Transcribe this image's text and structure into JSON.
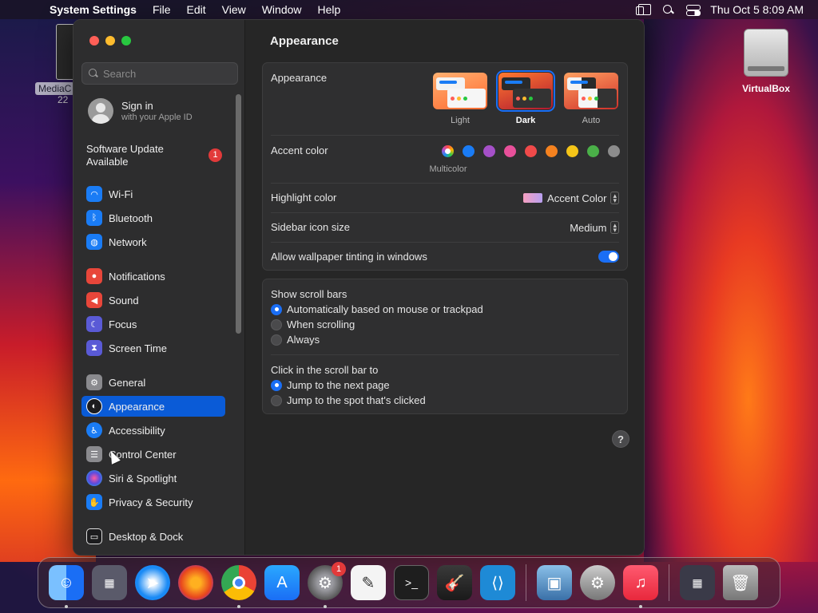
{
  "menubar": {
    "app_name": "System Settings",
    "items": [
      "File",
      "Edit",
      "View",
      "Window",
      "Help"
    ],
    "clock": "Thu Oct 5  8:09 AM"
  },
  "desktop": {
    "virtualbox_label": "VirtualBox",
    "mediac_label": "MediaC",
    "mediac_sub": "22"
  },
  "sidebar": {
    "search_placeholder": "Search",
    "signin_title": "Sign in",
    "signin_sub": "with your Apple ID",
    "update_line1": "Software Update",
    "update_line2": "Available",
    "update_badge": "1",
    "items": [
      {
        "label": "Wi-Fi",
        "icon": "wifi-icon",
        "color": "#1a7cf5"
      },
      {
        "label": "Bluetooth",
        "icon": "bluetooth-icon",
        "color": "#1a7cf5"
      },
      {
        "label": "Network",
        "icon": "globe-icon",
        "color": "#1a7cf5"
      },
      {
        "label": "Notifications",
        "icon": "bell-icon",
        "color": "#e8463a"
      },
      {
        "label": "Sound",
        "icon": "speaker-icon",
        "color": "#e8463a"
      },
      {
        "label": "Focus",
        "icon": "moon-icon",
        "color": "#5a5ad6"
      },
      {
        "label": "Screen Time",
        "icon": "hourglass-icon",
        "color": "#5a5ad6"
      },
      {
        "label": "General",
        "icon": "gear-icon",
        "color": "#8a8a8e"
      },
      {
        "label": "Appearance",
        "icon": "appearance-icon",
        "color": "#1c1c1e"
      },
      {
        "label": "Accessibility",
        "icon": "accessibility-icon",
        "color": "#1a7cf5"
      },
      {
        "label": "Control Center",
        "icon": "control-center-icon",
        "color": "#8a8a8e"
      },
      {
        "label": "Siri & Spotlight",
        "icon": "siri-icon",
        "color": "#9a4ae0"
      },
      {
        "label": "Privacy & Security",
        "icon": "hand-icon",
        "color": "#1a7cf5"
      },
      {
        "label": "Desktop & Dock",
        "icon": "dock-icon",
        "color": "#1c1c1e"
      }
    ]
  },
  "main": {
    "title": "Appearance",
    "appearance_label": "Appearance",
    "modes": [
      "Light",
      "Dark",
      "Auto"
    ],
    "selected_mode": "Dark",
    "accent_label": "Accent color",
    "accent_colors": [
      "multicolor",
      "#1a7cf5",
      "#a550c8",
      "#e8509a",
      "#f04a4a",
      "#f5821f",
      "#f5c518",
      "#4ab048",
      "#8c8c8c"
    ],
    "accent_caption": "Multicolor",
    "highlight_label": "Highlight color",
    "highlight_value": "Accent Color",
    "icon_size_label": "Sidebar icon size",
    "icon_size_value": "Medium",
    "tinting_label": "Allow wallpaper tinting in windows",
    "tinting_on": true,
    "scroll_title": "Show scroll bars",
    "scroll_options": [
      "Automatically based on mouse or trackpad",
      "When scrolling",
      "Always"
    ],
    "click_title": "Click in the scroll bar to",
    "click_options": [
      "Jump to the next page",
      "Jump to the spot that's clicked"
    ],
    "help": "?"
  },
  "dock": {
    "settings_badge": "1",
    "apps": [
      "Finder",
      "Launchpad",
      "Safari",
      "Firefox",
      "Chrome",
      "App Store",
      "System Settings",
      "TextEdit",
      "Terminal",
      "GarageBand",
      "VS Code",
      "Preview",
      "Automator",
      "Music",
      "Downloads",
      "Trash"
    ]
  }
}
